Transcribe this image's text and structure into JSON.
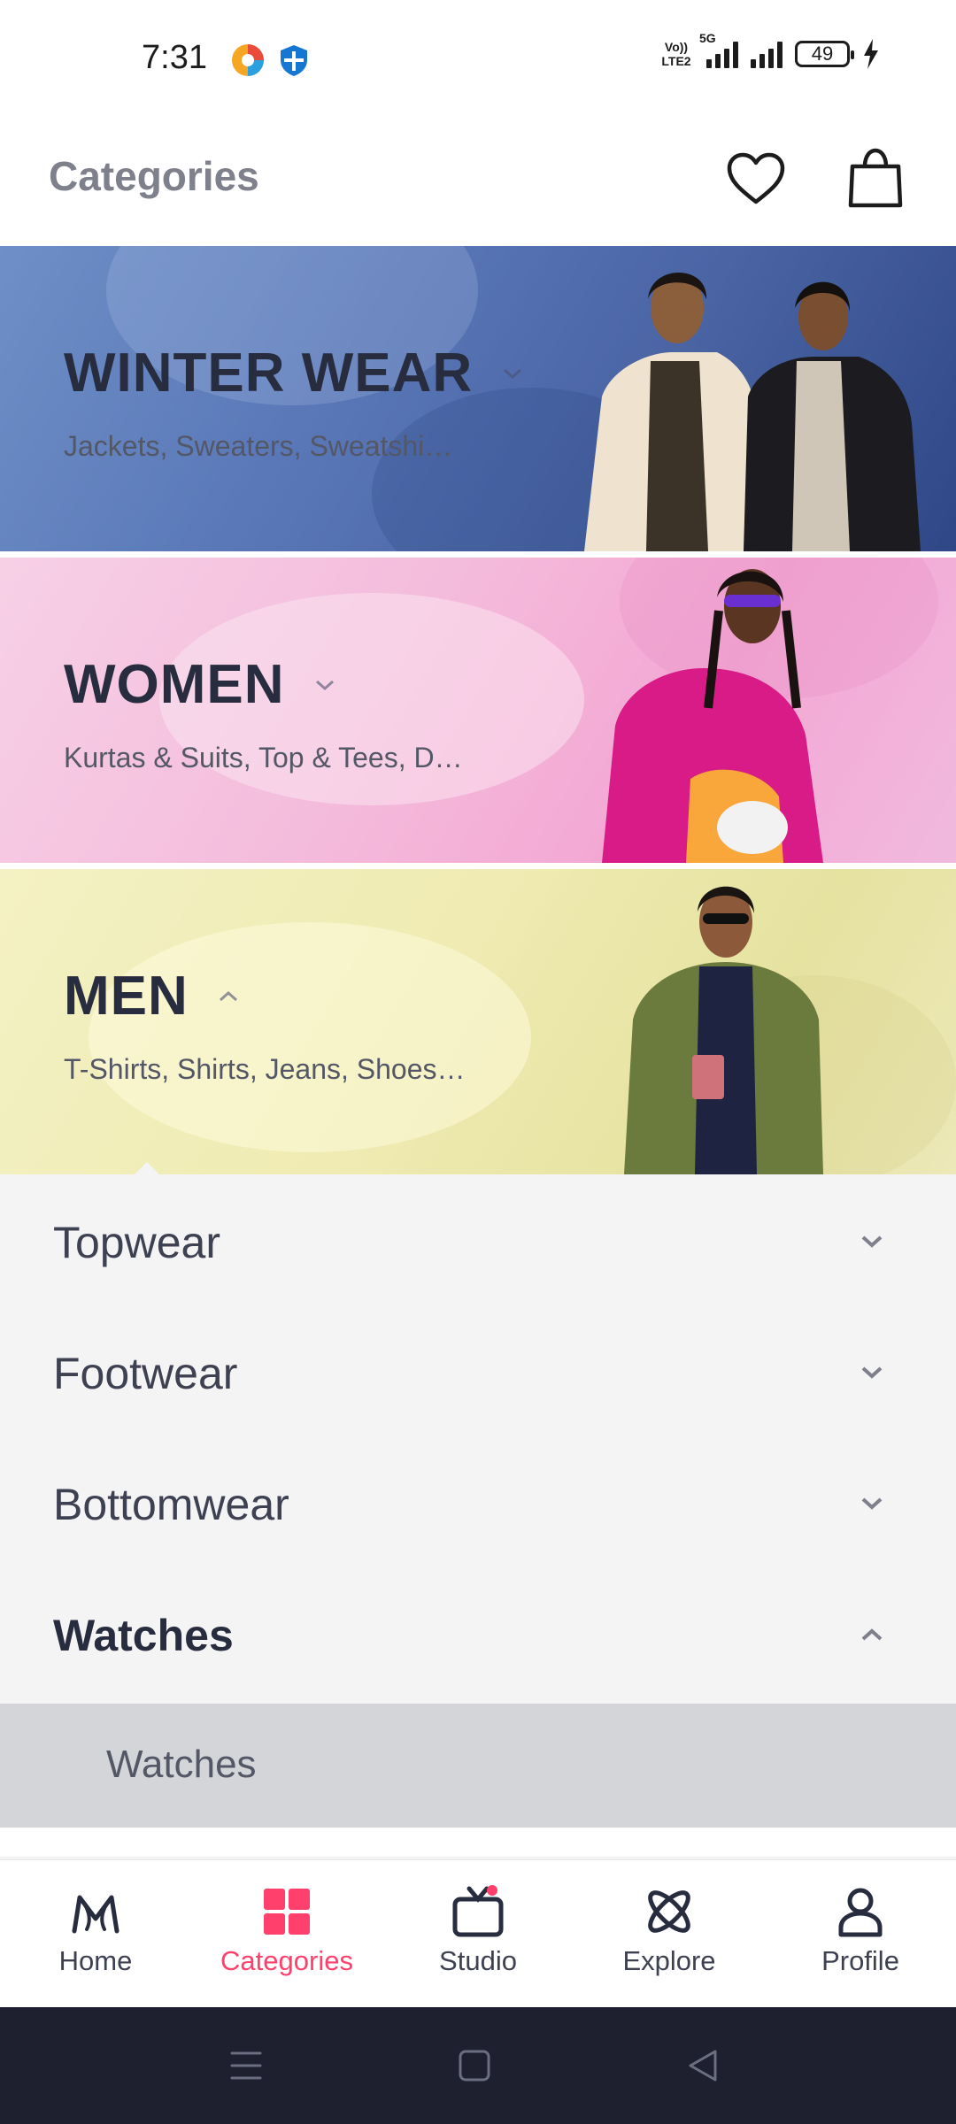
{
  "status_bar": {
    "time": "7:31",
    "network_label": "Vo)) LTE2",
    "network_type": "5G",
    "battery_level": "49"
  },
  "header": {
    "title": "Categories"
  },
  "banners": [
    {
      "title": "WINTER WEAR",
      "subtitle": "Jackets, Sweaters, Sweatshi…",
      "expanded": false
    },
    {
      "title": "WOMEN",
      "subtitle": "Kurtas & Suits, Top & Tees, D…",
      "expanded": false
    },
    {
      "title": "MEN",
      "subtitle": "T-Shirts, Shirts, Jeans, Shoes…",
      "expanded": true
    }
  ],
  "submenu": {
    "items": [
      {
        "label": "Topwear",
        "expanded": false
      },
      {
        "label": "Footwear",
        "expanded": false
      },
      {
        "label": "Bottomwear",
        "expanded": false
      },
      {
        "label": "Watches",
        "expanded": true
      }
    ],
    "leaf_items": [
      "Watches"
    ]
  },
  "bottom_nav": {
    "items": [
      {
        "label": "Home",
        "icon": "myntra-logo-icon"
      },
      {
        "label": "Categories",
        "icon": "grid-icon",
        "active": true
      },
      {
        "label": "Studio",
        "icon": "tv-icon"
      },
      {
        "label": "Explore",
        "icon": "atom-icon"
      },
      {
        "label": "Profile",
        "icon": "person-icon"
      }
    ]
  },
  "colors": {
    "accent": "#ff3f6c",
    "text_primary": "#282c3f",
    "text_muted": "#7e808c",
    "winter_banner": "#5a78b8",
    "women_banner": "#f4bcdc",
    "men_banner": "#efebb2"
  }
}
